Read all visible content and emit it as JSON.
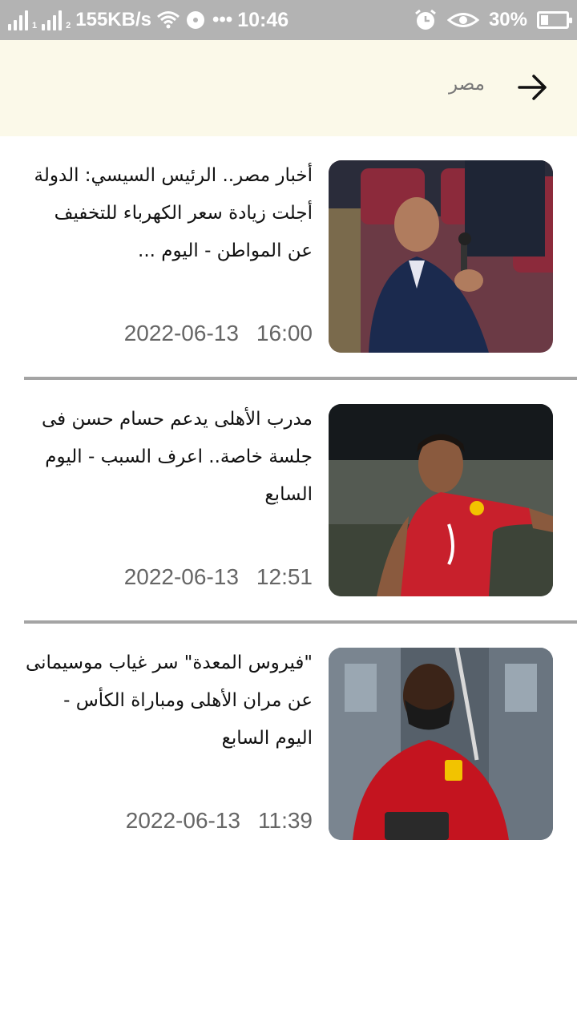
{
  "status_bar": {
    "sim1": "1",
    "sim2": "2",
    "network_speed": "155KB/s",
    "dots": "•••",
    "time": "10:46",
    "battery": "30%",
    "battery_level": 0.3
  },
  "header": {
    "title": "مصر",
    "back_icon": "arrow-right-icon",
    "background": "#fbf9e9"
  },
  "news": [
    {
      "title": "أخبار مصر.. الرئيس السيسي: الدولة أجلت زيادة سعر الكهرباء للتخفيف عن المواطن - اليوم ...",
      "date": "2022-06-13",
      "time": "16:00",
      "image": "president-speaking-photo"
    },
    {
      "title": "مدرب الأهلى يدعم حسام حسن فى جلسة خاصة.. اعرف السبب - اليوم السابع",
      "date": "2022-06-13",
      "time": "12:51",
      "image": "player-red-jersey-photo"
    },
    {
      "title": "\"فيروس المعدة\" سر غياب موسيمانى عن مران الأهلى ومباراة الكأس - اليوم السابع",
      "date": "2022-06-13",
      "time": "11:39",
      "image": "coach-masked-photo"
    }
  ]
}
